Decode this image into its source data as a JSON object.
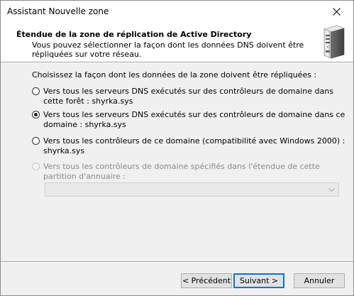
{
  "window": {
    "title": "Assistant Nouvelle zone"
  },
  "header": {
    "title": "Étendue de la zone de réplication de Active Directory",
    "subtitle": "Vous pouvez sélectionner la façon dont les données DNS doivent être répliquées sur votre réseau.",
    "icon": "server-icon"
  },
  "main": {
    "prompt": "Choisissez la façon dont les données de la zone doivent être répliquées :",
    "options": [
      {
        "label": "Vers tous les serveurs DNS exécutés sur des contrôleurs de domaine dans cette forêt : shyrka.sys",
        "checked": false,
        "enabled": true
      },
      {
        "label": "Vers tous les serveurs DNS exécutés sur des contrôleurs de domaine dans ce domaine : shyrka.sys",
        "checked": true,
        "enabled": true
      },
      {
        "label": "Vers tous les contrôleurs de ce domaine (compatibilité avec Windows 2000) : shyrka.sys",
        "checked": false,
        "enabled": true
      },
      {
        "label": "Vers tous les contrôleurs de domaine spécifiés dans l'étendue de cette partition d'annuaire :",
        "checked": false,
        "enabled": false
      }
    ],
    "partition_combo": {
      "value": "",
      "enabled": false
    }
  },
  "footer": {
    "back_label": "< Précédent",
    "next_label": "Suivant >",
    "cancel_label": "Annuler"
  },
  "colors": {
    "accent": "#0078d7",
    "disabled_text": "#8a8a8a"
  }
}
